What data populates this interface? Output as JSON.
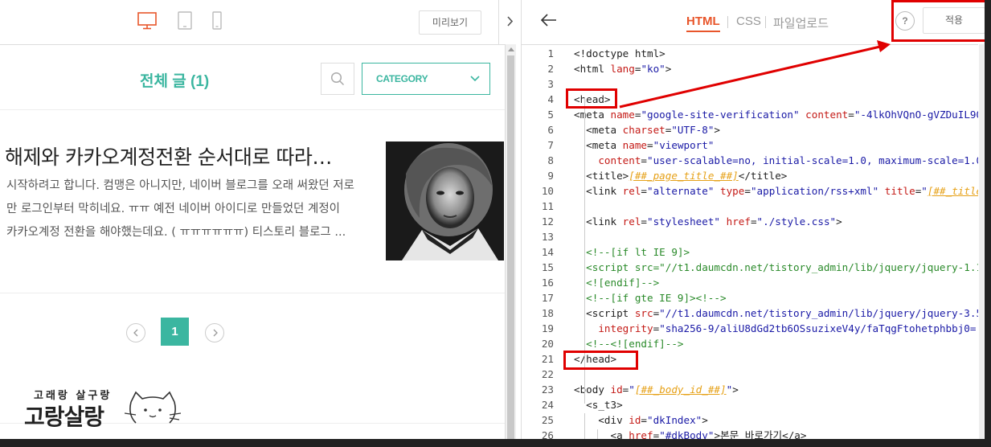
{
  "left": {
    "preview_label": "미리보기",
    "list_title": "전체 글 (1)",
    "category_label": "CATEGORY",
    "post": {
      "title": "해제와 카카오계정전환 순서대로 따라…",
      "excerpt": [
        "시작하려고 합니다. 컴맹은 아니지만, 네이버 블로그를 오래 써왔던 저로",
        "만 로그인부터 막히네요. ㅠㅠ   예전 네이버 아이디로 만들었던 계정이",
        "카카오계정 전환을 해야했는데요. ( ㅠㅠㅠㅠㅠㅠ) 티스토리 블로그 ..."
      ]
    },
    "page_number": "1",
    "logo_small": "고래랑 살구랑",
    "logo_big": "고랑살랑"
  },
  "right": {
    "tabs": [
      "HTML",
      "CSS",
      "파일업로드"
    ],
    "help_label": "?",
    "apply_label": "적용",
    "code_lines": [
      [
        [
          "<!doctype html>",
          "t-tag"
        ]
      ],
      [
        [
          "<html ",
          "t-tag"
        ],
        [
          "lang",
          "t-attr"
        ],
        [
          "=",
          "t-tag"
        ],
        [
          "\"ko\"",
          "t-val"
        ],
        [
          ">",
          "t-tag"
        ]
      ],
      [],
      [
        [
          "<head>",
          "t-tag"
        ]
      ],
      [
        [
          "<meta ",
          "t-tag"
        ],
        [
          "name",
          "t-attr"
        ],
        [
          "=",
          "t-tag"
        ],
        [
          "\"google-site-verification\"",
          "t-val"
        ],
        [
          " ",
          "t-tag"
        ],
        [
          "content",
          "t-attr"
        ],
        [
          "=",
          "t-tag"
        ],
        [
          "\"-4lkOhVQnO-gVZDuIL9Q",
          "t-val"
        ]
      ],
      [
        [
          "  <meta ",
          "t-tag"
        ],
        [
          "charset",
          "t-attr"
        ],
        [
          "=",
          "t-tag"
        ],
        [
          "\"UTF-8\"",
          "t-val"
        ],
        [
          ">",
          "t-tag"
        ]
      ],
      [
        [
          "  <meta ",
          "t-tag"
        ],
        [
          "name",
          "t-attr"
        ],
        [
          "=",
          "t-tag"
        ],
        [
          "\"viewport\"",
          "t-val"
        ]
      ],
      [
        [
          "    ",
          "t-tag"
        ],
        [
          "content",
          "t-attr"
        ],
        [
          "=",
          "t-tag"
        ],
        [
          "\"user-scalable=no, initial-scale=1.0, maximum-scale=1.0",
          "t-val"
        ]
      ],
      [
        [
          "  <title>",
          "t-tag"
        ],
        [
          "[##_page_title_##]",
          "t-tpl"
        ],
        [
          "</title>",
          "t-tag"
        ]
      ],
      [
        [
          "  <link ",
          "t-tag"
        ],
        [
          "rel",
          "t-attr"
        ],
        [
          "=",
          "t-tag"
        ],
        [
          "\"alternate\"",
          "t-val"
        ],
        [
          " ",
          "t-tag"
        ],
        [
          "type",
          "t-attr"
        ],
        [
          "=",
          "t-tag"
        ],
        [
          "\"application/rss+xml\"",
          "t-val"
        ],
        [
          " ",
          "t-tag"
        ],
        [
          "title",
          "t-attr"
        ],
        [
          "=",
          "t-tag"
        ],
        [
          "\"",
          "t-val"
        ],
        [
          "[##_title",
          "t-tpl"
        ]
      ],
      [],
      [
        [
          "  <link ",
          "t-tag"
        ],
        [
          "rel",
          "t-attr"
        ],
        [
          "=",
          "t-tag"
        ],
        [
          "\"stylesheet\"",
          "t-val"
        ],
        [
          " ",
          "t-tag"
        ],
        [
          "href",
          "t-attr"
        ],
        [
          "=",
          "t-tag"
        ],
        [
          "\"./style.css\"",
          "t-val"
        ],
        [
          ">",
          "t-tag"
        ]
      ],
      [],
      [
        [
          "  <!--[if lt IE 9]>",
          "t-com"
        ]
      ],
      [
        [
          "  <script src=\"//t1.daumcdn.net/tistory_admin/lib/jquery/jquery-1.1",
          "t-com"
        ]
      ],
      [
        [
          "  <![endif]-->",
          "t-com"
        ]
      ],
      [
        [
          "  <!--[if gte IE 9]><!-->",
          "t-com"
        ]
      ],
      [
        [
          "  <script ",
          "t-tag"
        ],
        [
          "src",
          "t-attr"
        ],
        [
          "=",
          "t-tag"
        ],
        [
          "\"//t1.daumcdn.net/tistory_admin/lib/jquery/jquery-3.5",
          "t-val"
        ]
      ],
      [
        [
          "    ",
          "t-tag"
        ],
        [
          "integrity",
          "t-attr"
        ],
        [
          "=",
          "t-tag"
        ],
        [
          "\"sha256-9/aliU8dGd2tb6OSsuzixeV4y/faTqgFtohetphbbj0=",
          "t-val"
        ]
      ],
      [
        [
          "  <!--<![endif]-->",
          "t-com"
        ]
      ],
      [
        [
          "</head>",
          "t-tag"
        ]
      ],
      [],
      [
        [
          "<body ",
          "t-tag"
        ],
        [
          "id",
          "t-attr"
        ],
        [
          "=",
          "t-tag"
        ],
        [
          "\"",
          "t-val"
        ],
        [
          "[##_body_id_##]",
          "t-tpl"
        ],
        [
          "\"",
          "t-val"
        ],
        [
          ">",
          "t-tag"
        ]
      ],
      [
        [
          "  <s_t3>",
          "t-tag"
        ]
      ],
      [
        [
          "    <div ",
          "t-tag"
        ],
        [
          "id",
          "t-attr"
        ],
        [
          "=",
          "t-tag"
        ],
        [
          "\"dkIndex\"",
          "t-val"
        ],
        [
          ">",
          "t-tag"
        ]
      ],
      [
        [
          "      <a ",
          "t-tag"
        ],
        [
          "href",
          "t-attr"
        ],
        [
          "=",
          "t-tag"
        ],
        [
          "\"#dkBody\"",
          "t-val"
        ],
        [
          ">본문 바로가기</a>",
          "t-tag"
        ]
      ]
    ]
  },
  "colors": {
    "accent": "#3bb6a0",
    "tab_active": "#e8562b",
    "highlight": "#e00000"
  }
}
